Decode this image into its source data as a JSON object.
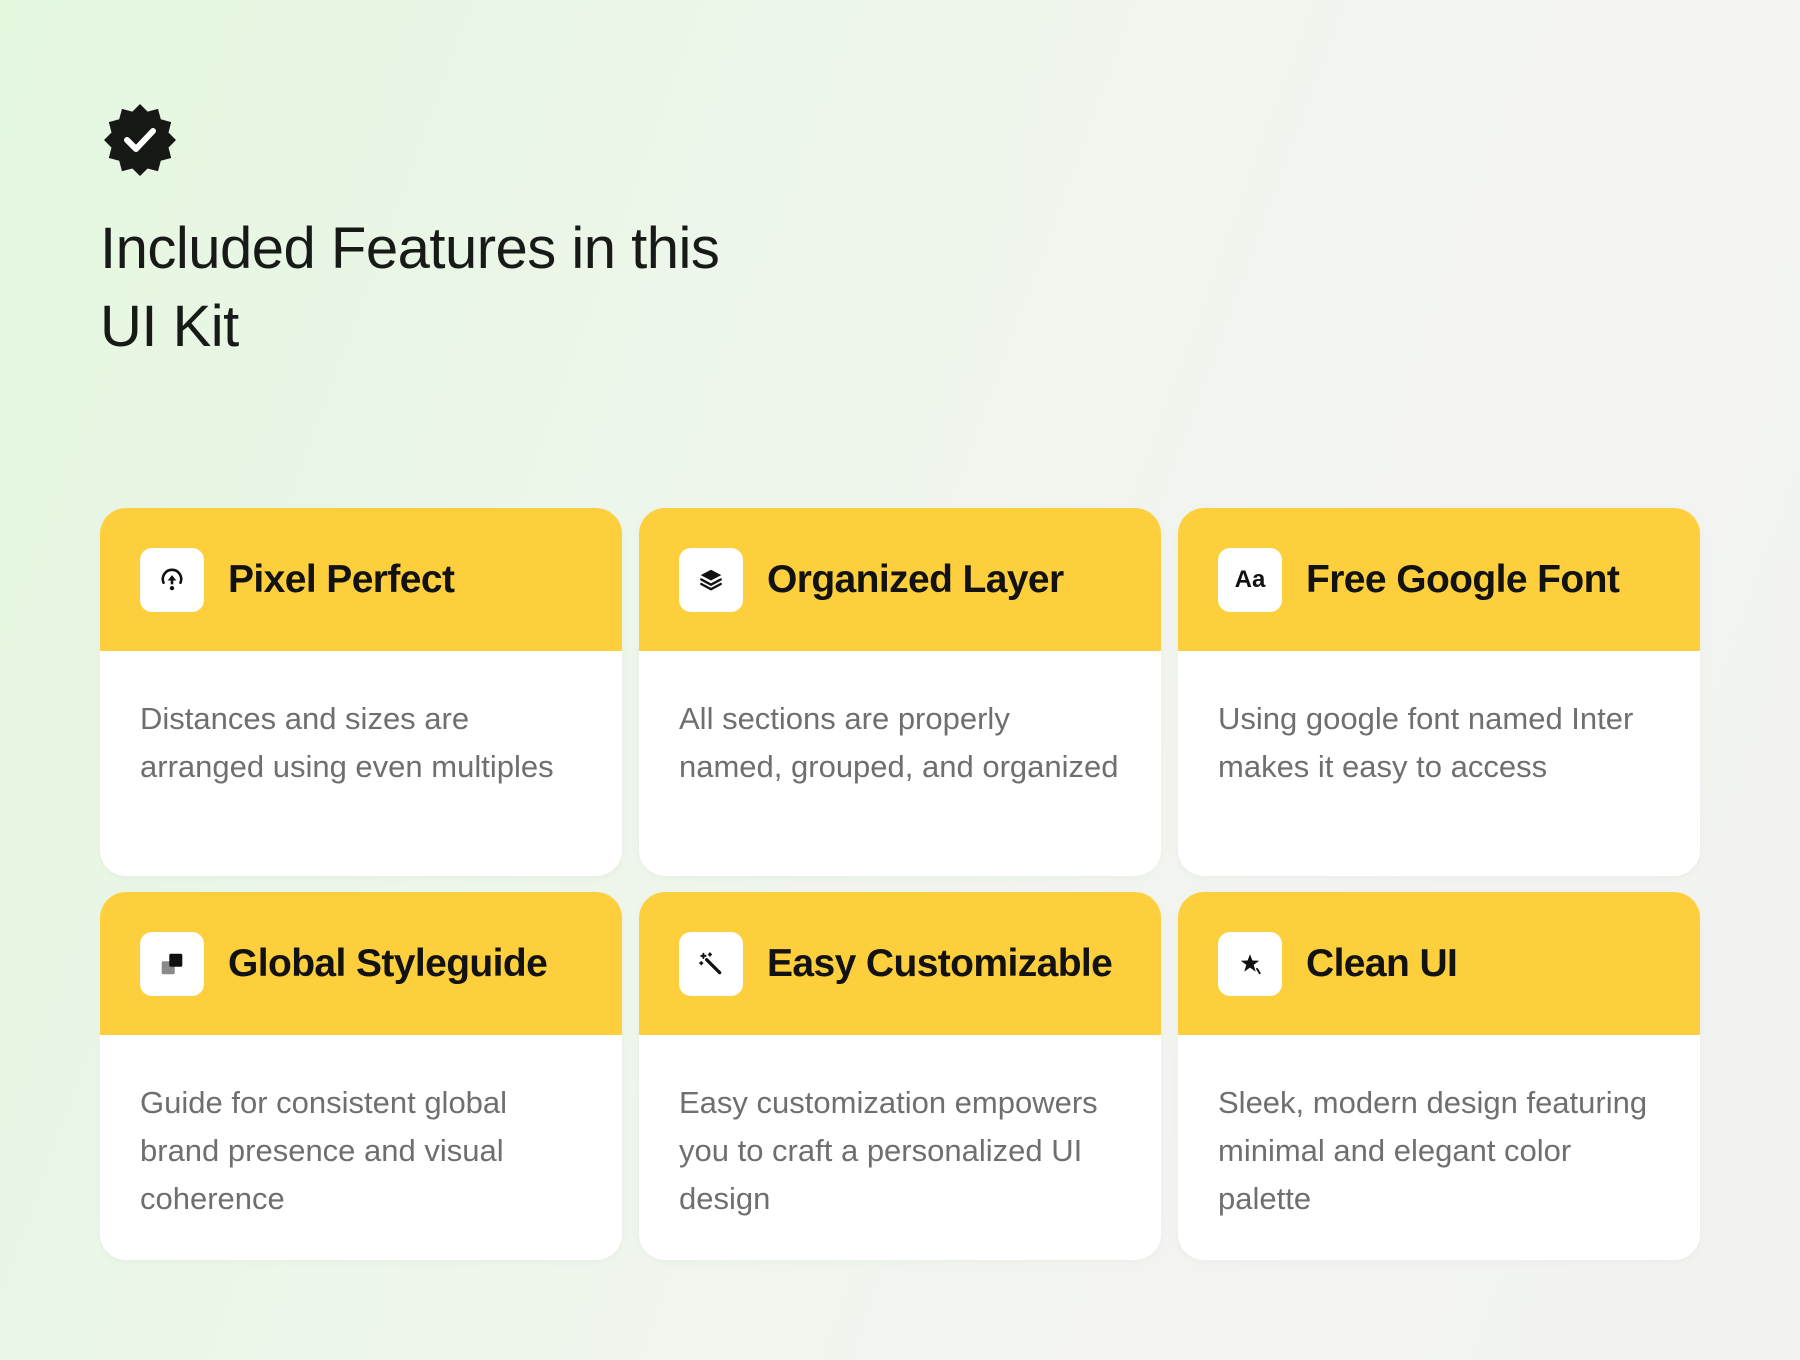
{
  "page": {
    "headline": "Included Features in this UI Kit",
    "badge_icon": "verified-check-badge-icon"
  },
  "colors": {
    "accent_yellow": "#fecf3c",
    "card_bg": "#ffffff",
    "heading": "#171a17",
    "body_text": "#6e706e"
  },
  "features": [
    {
      "title": "Pixel Perfect",
      "icon": "pixel-perfect-icon",
      "description": "Distances and sizes are arranged using even multiples"
    },
    {
      "title": "Organized Layer",
      "icon": "layers-icon",
      "description": "All sections are properly named, grouped, and organized"
    },
    {
      "title": "Free Google Font",
      "icon": "font-icon",
      "icon_text": "Aa",
      "description": "Using google font named Inter makes it easy  to access"
    },
    {
      "title": "Global Styleguide",
      "icon": "styleguide-icon",
      "description": "Guide for consistent global brand presence and visual coherence"
    },
    {
      "title": "Easy Customizable",
      "icon": "magic-wand-icon",
      "description": "Easy customization empowers you to craft a personalized UI design"
    },
    {
      "title": "Clean UI",
      "icon": "sparkle-icon",
      "description": "Sleek, modern design featuring minimal and elegant color palette"
    }
  ]
}
